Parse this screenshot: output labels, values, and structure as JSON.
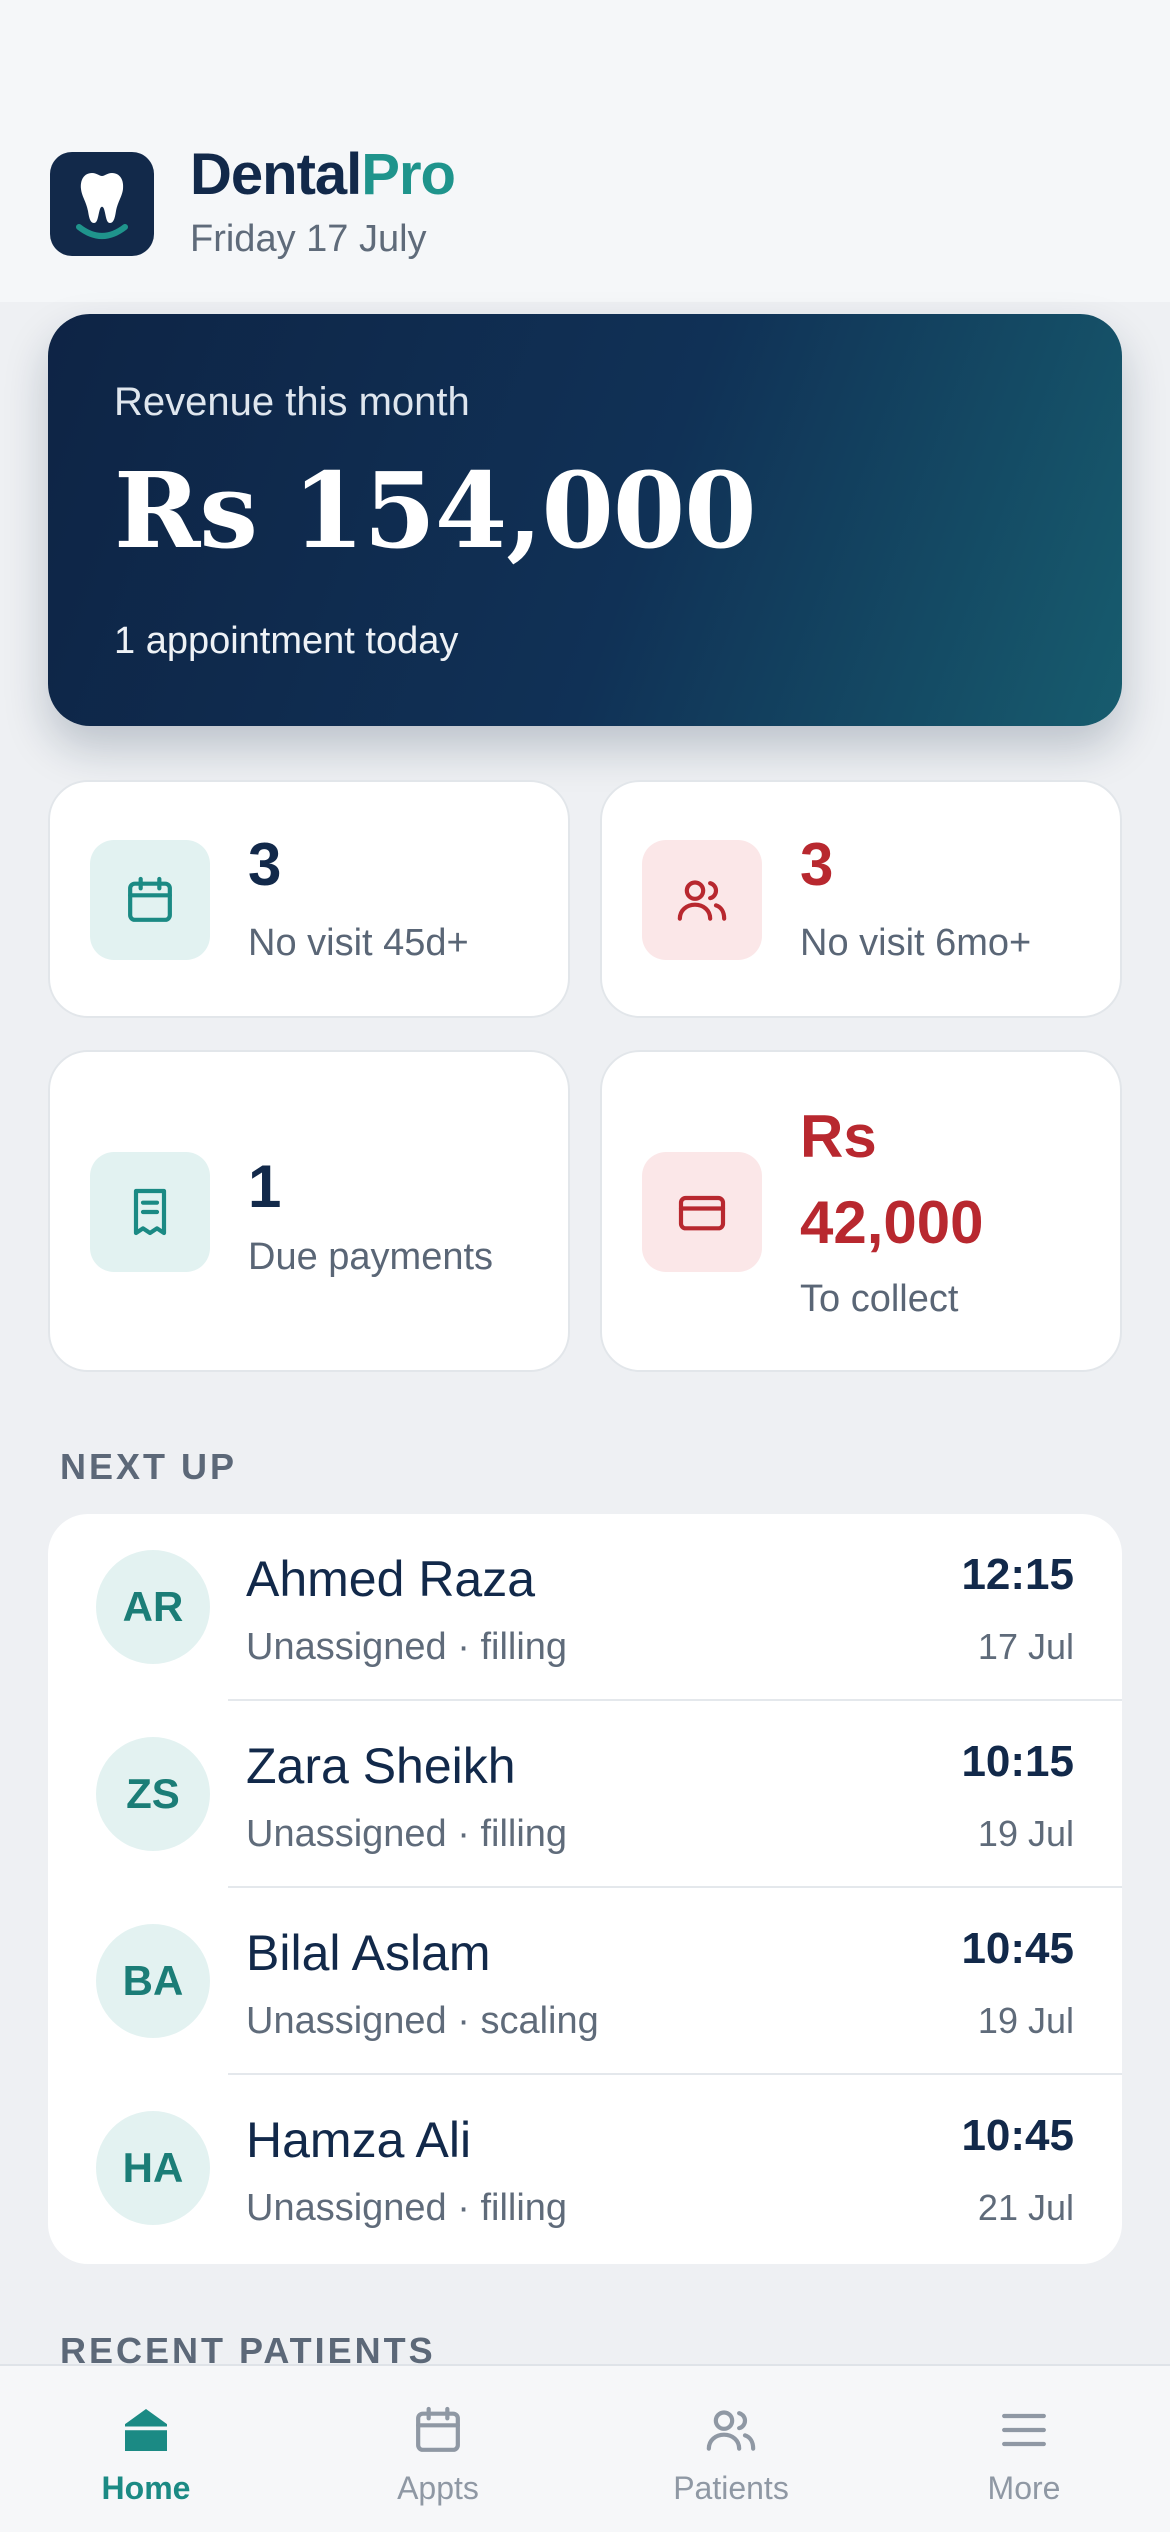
{
  "header": {
    "brand_part1": "Dental",
    "brand_part2": "Pro",
    "date": "Friday 17 July",
    "logo_icon": "tooth-icon"
  },
  "revenue": {
    "label": "Revenue this month",
    "value": "Rs 154,000",
    "subtitle": "1 appointment today"
  },
  "stats": [
    {
      "icon": "calendar-icon",
      "value": "3",
      "label": "No visit 45d+"
    },
    {
      "icon": "users-icon",
      "value": "3",
      "label": "No visit 6mo+"
    },
    {
      "icon": "receipt-icon",
      "value": "1",
      "label": "Due payments"
    },
    {
      "icon": "credit-card-icon",
      "value_line1": "Rs",
      "value_line2": "42,000",
      "label": "To collect"
    }
  ],
  "next_up": {
    "title": "NEXT UP",
    "items": [
      {
        "initials": "AR",
        "name": "Ahmed Raza",
        "meta": "Unassigned · filling",
        "time": "12:15",
        "date": "17 Jul"
      },
      {
        "initials": "ZS",
        "name": "Zara Sheikh",
        "meta": "Unassigned · filling",
        "time": "10:15",
        "date": "19 Jul"
      },
      {
        "initials": "BA",
        "name": "Bilal Aslam",
        "meta": "Unassigned · scaling",
        "time": "10:45",
        "date": "19 Jul"
      },
      {
        "initials": "HA",
        "name": "Hamza Ali",
        "meta": "Unassigned · filling",
        "time": "10:45",
        "date": "21 Jul"
      }
    ]
  },
  "recent_patients": {
    "title": "RECENT PATIENTS"
  },
  "tabbar": {
    "tabs": [
      {
        "label": "Home",
        "icon": "home-icon",
        "active": true
      },
      {
        "label": "Appts",
        "icon": "calendar-icon",
        "active": false
      },
      {
        "label": "Patients",
        "icon": "users-icon",
        "active": false
      },
      {
        "label": "More",
        "icon": "menu-icon",
        "active": false
      }
    ]
  },
  "colors": {
    "navy": "#12294a",
    "teal": "#1f948c",
    "alert_red": "#b8282f"
  }
}
